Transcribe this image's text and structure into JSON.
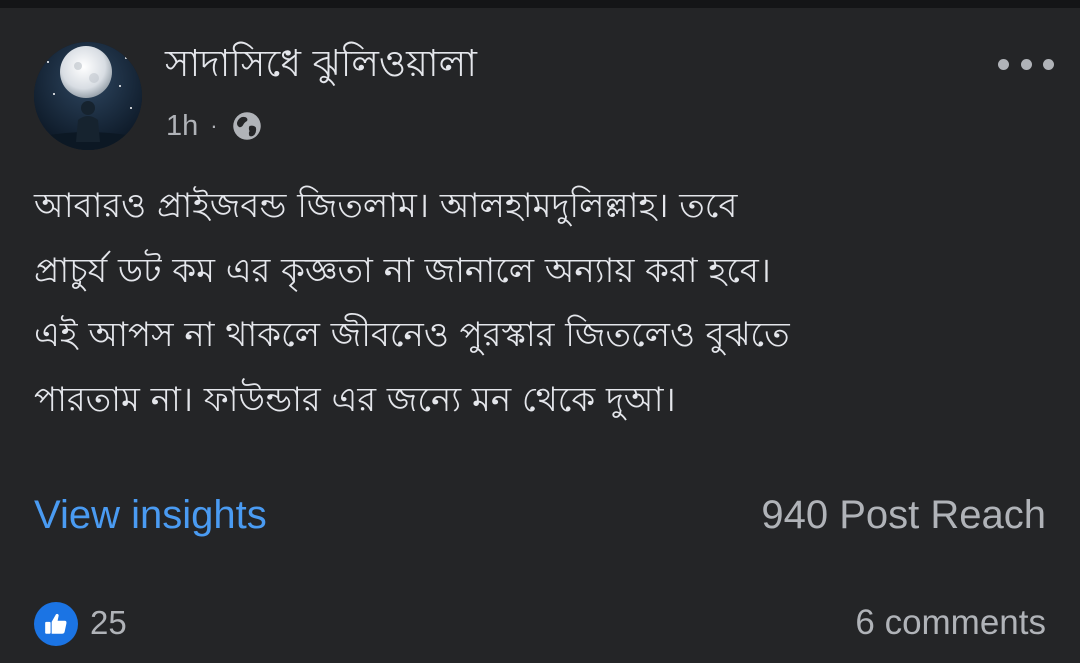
{
  "post": {
    "author": "সাদাসিধে ঝুলিওয়ালা",
    "time": "1h",
    "separator": "·",
    "privacy_icon": "globe-icon",
    "more_icon": "more-options-icon",
    "text_lines": [
      "আবারও প্রাইজবন্ড জিতলাম। আলহামদুলিল্লাহ। তবে",
      "প্রাচুর্য ডট কম এর কৃজ্ঞতা না জানালে অন্যায় করা হবে।",
      "এই আপস না থাকলে জীবনেও পুরস্কার জিতলেও বুঝতে",
      "পারতাম না। ফাউন্ডার এর জন্যে মন থেকে দুআ।"
    ]
  },
  "insights": {
    "link_label": "View insights",
    "reach_label": "940 Post Reach"
  },
  "reactions": {
    "icon": "thumbs-up-icon",
    "count": "25",
    "comments_label": "6 comments"
  },
  "colors": {
    "background": "#242527",
    "text": "#e4e6eb",
    "secondary_text": "#b0b3b8",
    "link": "#4a9bf2",
    "like_blue": "#1b74e4"
  }
}
